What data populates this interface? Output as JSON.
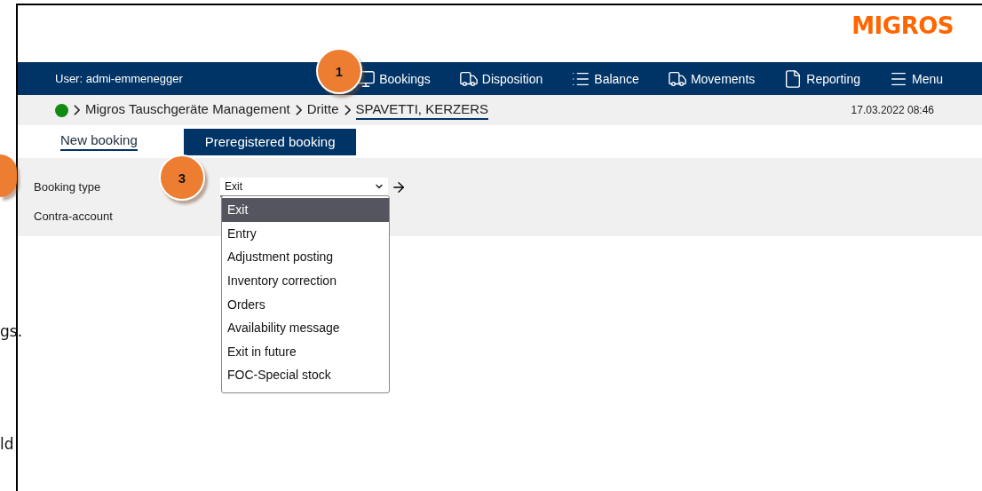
{
  "document_fragments": [
    "gs.",
    "ld"
  ],
  "callouts": [
    {
      "number": "1"
    },
    {
      "number": "3"
    }
  ],
  "header": {
    "logo": "MIGROS"
  },
  "nav": {
    "user": "User: admi-emmenegger",
    "items": [
      {
        "label": "Bookings",
        "kind": "monitor"
      },
      {
        "label": "Disposition",
        "kind": "truck"
      },
      {
        "label": "Balance",
        "kind": "list"
      },
      {
        "label": "Movements",
        "kind": "truck"
      },
      {
        "label": "Reporting",
        "kind": "document"
      },
      {
        "label": "Menu",
        "kind": "menu"
      }
    ]
  },
  "breadcrumb": {
    "status": {
      "color": "#118a11"
    },
    "items": [
      {
        "label": "Migros Tauschgeräte Management",
        "current": false
      },
      {
        "label": "Dritte",
        "current": false
      },
      {
        "label": "SPAVETTI, KERZERS",
        "current": true
      }
    ],
    "timestamp": "17.03.2022 08:46"
  },
  "tabs": [
    {
      "label": "New booking",
      "selected": true
    },
    {
      "label": "Preregistered booking",
      "selected": false
    }
  ],
  "form": {
    "fields": [
      {
        "label": "Booking type",
        "kind": "select",
        "value": "Exit"
      },
      {
        "label": "Contra-account",
        "kind": "empty"
      }
    ]
  },
  "dropdown": {
    "options": [
      {
        "label": "Exit",
        "selected": true
      },
      {
        "label": "Entry",
        "selected": false
      },
      {
        "label": "Adjustment posting",
        "selected": false
      },
      {
        "label": "Inventory correction",
        "selected": false
      },
      {
        "label": "Orders",
        "selected": false
      },
      {
        "label": "Availability message",
        "selected": false
      },
      {
        "label": "Exit in future",
        "selected": false
      },
      {
        "label": "FOC-Special stock",
        "selected": false
      }
    ]
  }
}
